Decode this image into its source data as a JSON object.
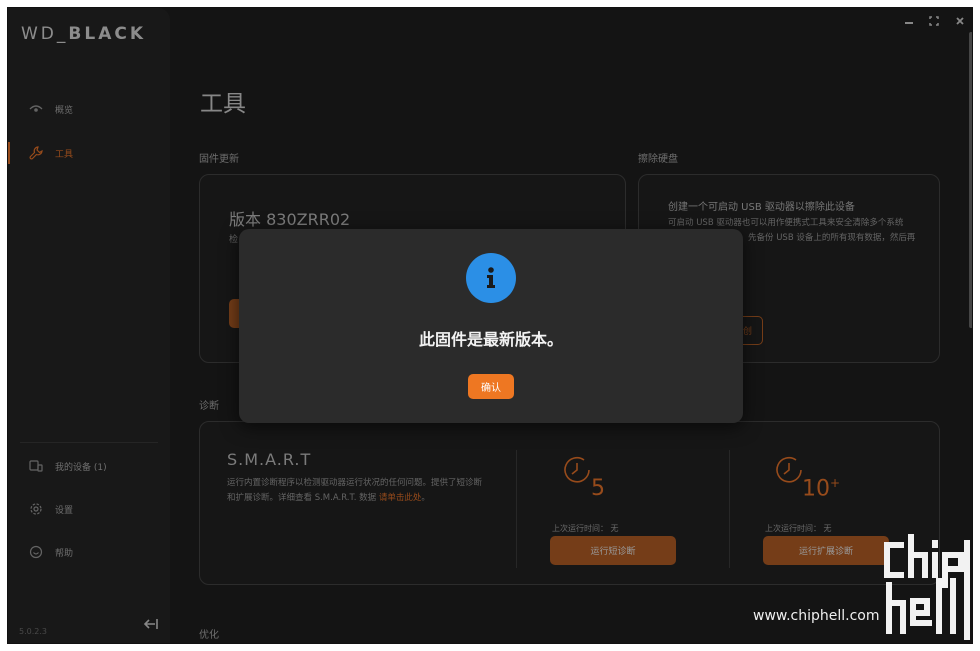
{
  "app": {
    "logo_text_light": "WD_",
    "logo_text_bold": "BLACK",
    "version": "5.0.2.3"
  },
  "sidebar": {
    "items": [
      {
        "label": "概览",
        "icon": "eye-icon",
        "active": false
      },
      {
        "label": "工具",
        "icon": "wrench-icon",
        "active": true
      }
    ],
    "bottom_items": [
      {
        "label": "我的设备 (1)",
        "icon": "devices-icon"
      },
      {
        "label": "设置",
        "icon": "gear-icon"
      },
      {
        "label": "帮助",
        "icon": "help-icon"
      }
    ]
  },
  "main": {
    "title": "工具",
    "firmware": {
      "section": "固件更新",
      "version_label": "版本 830ZRR02",
      "check_text_fragment": "检"
    },
    "erase": {
      "section": "擦除硬盘",
      "heading": "创建一个可启动 USB 驱动器以擦除此设备",
      "line1": "可启动 USB 驱动器也可以用作便携式工具来安全清除多个系统",
      "line2": "先备份 USB 设备上的所有现有数据，然后再",
      "button_fragment": "创"
    },
    "diagnostics": {
      "section": "诊断",
      "smart_title": "S.M.A.R.T",
      "smart_desc_1": "运行内置诊断程序以检测驱动器运行状况的任何问题。提供了短诊断",
      "smart_desc_2": "和扩展诊断。详细查看 S.M.A.R.T. 数据",
      "smart_link": "请单击此处",
      "smart_desc_end": "。",
      "short": {
        "minutes": "5",
        "last_run": "上次运行时间：  无",
        "button": "运行短诊断"
      },
      "extended": {
        "minutes": "10",
        "minutes_suffix": "+",
        "last_run": "上次运行时间：  无",
        "button": "运行扩展诊断"
      }
    },
    "next_section_fragment": "优化"
  },
  "dialog": {
    "message": "此固件是最新版本。",
    "confirm": "确认"
  },
  "watermark": {
    "url": "www.chiphell.com",
    "logo": "chiphell-logo"
  },
  "colors": {
    "accent": "#e8732a",
    "info": "#2b8fe6",
    "background": "#1f1f1f"
  }
}
